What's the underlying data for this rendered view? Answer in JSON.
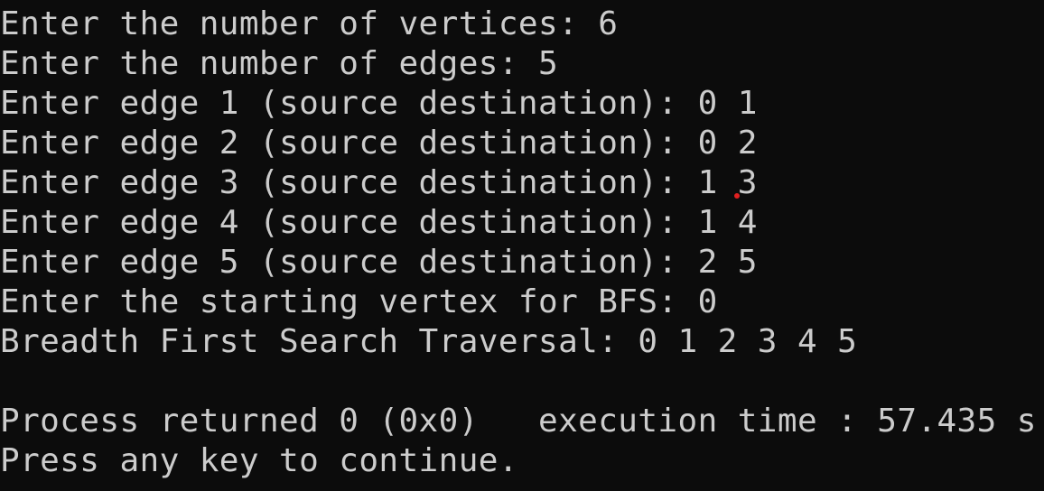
{
  "console": {
    "lines": [
      "Enter the number of vertices: 6",
      "Enter the number of edges: 5",
      "Enter edge 1 (source destination): 0 1",
      "Enter edge 2 (source destination): 0 2",
      "Enter edge 3 (source destination): 1 3",
      "Enter edge 4 (source destination): 1 4",
      "Enter edge 5 (source destination): 2 5",
      "Enter the starting vertex for BFS: 0",
      "Breadth First Search Traversal: 0 1 2 3 4 5",
      "",
      "Process returned 0 (0x0)   execution time : 57.435 s",
      "Press any key to continue."
    ]
  },
  "colors": {
    "background": "#0c0c0c",
    "text": "#cccccc",
    "marker": "#e02020"
  }
}
